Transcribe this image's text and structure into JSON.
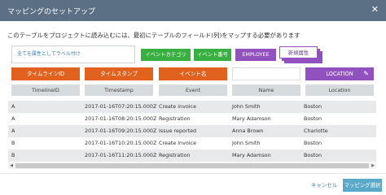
{
  "dialog": {
    "title": "マッピングのセットアップ",
    "close_glyph": "✕",
    "instruction": "このテーブルをプロジェクトに読み込むには、最初にテーブルのフィールド(列)をマップする必要があります"
  },
  "assign_all_label": "全てを属性としてラベル付け",
  "chips": {
    "event_category": "イベントカテゴリ",
    "event_number": "イベント番号",
    "employee": "EMPLOYEE",
    "new_attribute": "新規属性"
  },
  "mapping_slots": {
    "timeline_id": "タイムラインID",
    "timestamp": "タイムスタンプ",
    "event_name": "イベント名",
    "empty": "",
    "location": "LOCATION"
  },
  "columns": [
    "TimelineID",
    "Timestamp",
    "Event",
    "Name",
    "Location"
  ],
  "rows": [
    [
      "A",
      "2017-01-16T07:20:15.000Z",
      "Create invoice",
      "John Smith",
      "Boston"
    ],
    [
      "A",
      "2017-01-16T08:20:15.000Z",
      "Registration",
      "Mary Adamson",
      "Boston"
    ],
    [
      "A",
      "2017-01-16T09:20:15.000Z",
      "Issue reported",
      "Anna Brown",
      "Charlotte"
    ],
    [
      "B",
      "2017-01-16T10:20:15.000Z",
      "Create invoice",
      "John Smith",
      "Boston"
    ],
    [
      "B",
      "2017-01-16T11:20:15.000Z",
      "Registration",
      "Mary Adamson",
      "Boston"
    ]
  ],
  "footer": {
    "cancel": "キャンセル",
    "select_mapping": "マッピング選択"
  },
  "colors": {
    "titlebar": "#5c7085",
    "orange": "#e0621e",
    "green": "#3aaf41",
    "purple": "#9152c0",
    "button": "#5aa9c9"
  },
  "icons": [
    "close-icon",
    "pencil-icon",
    "scroll-left-icon",
    "scroll-right-icon"
  ]
}
